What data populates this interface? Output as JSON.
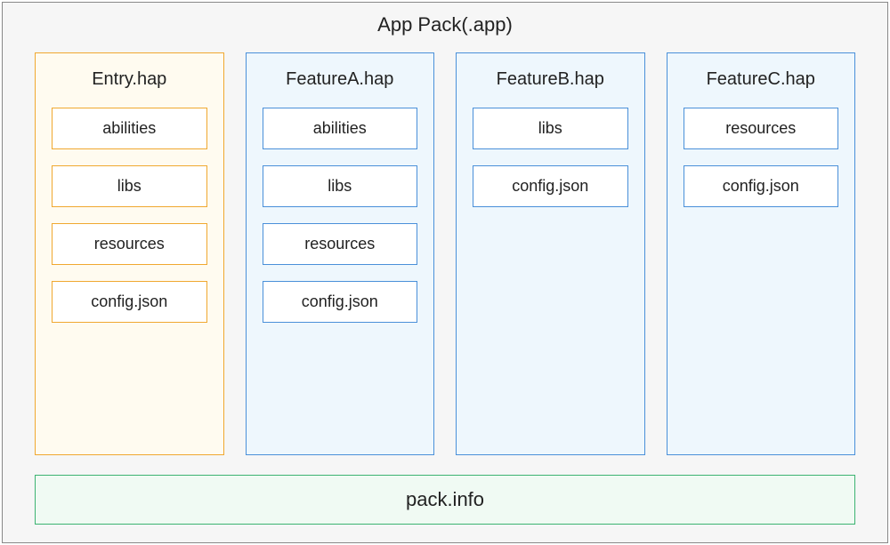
{
  "title": "App Pack(.app)",
  "columns": [
    {
      "name": "Entry.hap",
      "type": "entry",
      "items": [
        "abilities",
        "libs",
        "resources",
        "config.json"
      ]
    },
    {
      "name": "FeatureA.hap",
      "type": "feature",
      "items": [
        "abilities",
        "libs",
        "resources",
        "config.json"
      ]
    },
    {
      "name": "FeatureB.hap",
      "type": "feature",
      "items": [
        "libs",
        "config.json"
      ]
    },
    {
      "name": "FeatureC.hap",
      "type": "feature",
      "items": [
        "resources",
        "config.json"
      ]
    }
  ],
  "footer": "pack.info"
}
